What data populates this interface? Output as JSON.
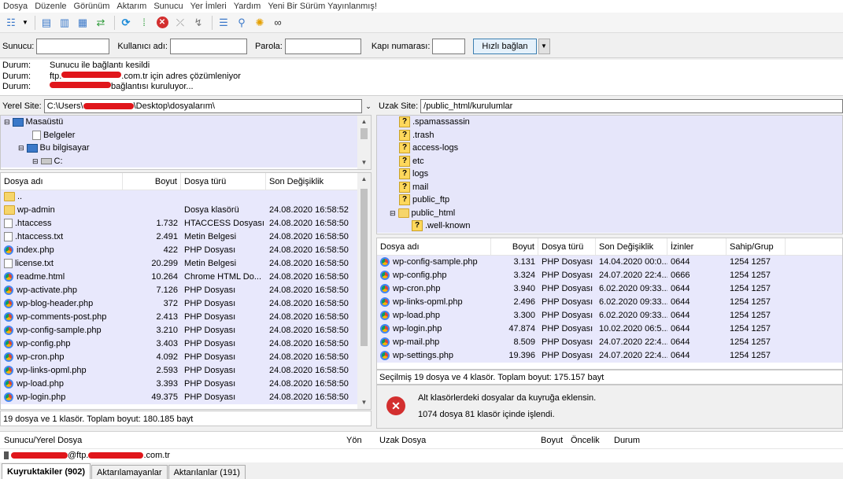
{
  "menu": [
    "Dosya",
    "Düzenle",
    "Görünüm",
    "Aktarım",
    "Sunucu",
    "Yer İmleri",
    "Yardım",
    "Yeni Bir Sürüm Yayınlanmış!"
  ],
  "quick": {
    "host_label": "Sunucu:",
    "user_label": "Kullanıcı adı:",
    "pass_label": "Parola:",
    "port_label": "Kapı numarası:",
    "connect_label": "Hızlı bağlan"
  },
  "log": [
    {
      "key": "Durum:",
      "msg": "Sunucu ile bağlantı kesildi"
    },
    {
      "key": "Durum:",
      "msg_pre": "ftp.",
      "msg_post": ".com.tr için adres çözümleniyor"
    },
    {
      "key": "Durum:",
      "msg_post": " bağlantısı kuruluyor..."
    }
  ],
  "local": {
    "label": "Yerel Site:",
    "path_pre": "C:\\Users\\",
    "path_post": "\\Desktop\\dosyalarım\\",
    "tree": [
      {
        "name": "Masaüstü",
        "icon": "monitor-icon",
        "indent": 0
      },
      {
        "name": "Belgeler",
        "icon": "document-icon",
        "indent": 1
      },
      {
        "name": "Bu bilgisayar",
        "icon": "monitor-icon",
        "indent": 1
      },
      {
        "name": "C:",
        "icon": "drive-icon",
        "indent": 2
      }
    ],
    "columns": [
      "Dosya adı",
      "Boyut",
      "Dosya türü",
      "Son Değişiklik"
    ],
    "files": [
      {
        "name": "..",
        "size": "",
        "type": "",
        "date": "",
        "icon": "folder"
      },
      {
        "name": "wp-admin",
        "size": "",
        "type": "Dosya klasörü",
        "date": "24.08.2020 16:58:52",
        "icon": "folder"
      },
      {
        "name": ".htaccess",
        "size": "1.732",
        "type": "HTACCESS Dosyası",
        "date": "24.08.2020 16:58:50",
        "icon": "file"
      },
      {
        "name": ".htaccess.txt",
        "size": "2.491",
        "type": "Metin Belgesi",
        "date": "24.08.2020 16:58:50",
        "icon": "file"
      },
      {
        "name": "index.php",
        "size": "422",
        "type": "PHP Dosyası",
        "date": "24.08.2020 16:58:50",
        "icon": "chrome"
      },
      {
        "name": "license.txt",
        "size": "20.299",
        "type": "Metin Belgesi",
        "date": "24.08.2020 16:58:50",
        "icon": "file"
      },
      {
        "name": "readme.html",
        "size": "10.264",
        "type": "Chrome HTML Do...",
        "date": "24.08.2020 16:58:50",
        "icon": "chrome"
      },
      {
        "name": "wp-activate.php",
        "size": "7.126",
        "type": "PHP Dosyası",
        "date": "24.08.2020 16:58:50",
        "icon": "chrome"
      },
      {
        "name": "wp-blog-header.php",
        "size": "372",
        "type": "PHP Dosyası",
        "date": "24.08.2020 16:58:50",
        "icon": "chrome"
      },
      {
        "name": "wp-comments-post.php",
        "size": "2.413",
        "type": "PHP Dosyası",
        "date": "24.08.2020 16:58:50",
        "icon": "chrome"
      },
      {
        "name": "wp-config-sample.php",
        "size": "3.210",
        "type": "PHP Dosyası",
        "date": "24.08.2020 16:58:50",
        "icon": "chrome"
      },
      {
        "name": "wp-config.php",
        "size": "3.403",
        "type": "PHP Dosyası",
        "date": "24.08.2020 16:58:50",
        "icon": "chrome"
      },
      {
        "name": "wp-cron.php",
        "size": "4.092",
        "type": "PHP Dosyası",
        "date": "24.08.2020 16:58:50",
        "icon": "chrome"
      },
      {
        "name": "wp-links-opml.php",
        "size": "2.593",
        "type": "PHP Dosyası",
        "date": "24.08.2020 16:58:50",
        "icon": "chrome"
      },
      {
        "name": "wp-load.php",
        "size": "3.393",
        "type": "PHP Dosyası",
        "date": "24.08.2020 16:58:50",
        "icon": "chrome"
      },
      {
        "name": "wp-login.php",
        "size": "49.375",
        "type": "PHP Dosyası",
        "date": "24.08.2020 16:58:50",
        "icon": "chrome"
      }
    ],
    "status": "19 dosya ve 1 klasör. Toplam boyut: 180.185 bayt"
  },
  "remote": {
    "label": "Uzak Site:",
    "path": "/public_html/kurulumlar",
    "tree": [
      {
        "name": ".spamassassin",
        "indent": 1
      },
      {
        "name": ".trash",
        "indent": 1
      },
      {
        "name": "access-logs",
        "indent": 1
      },
      {
        "name": "etc",
        "indent": 1
      },
      {
        "name": "logs",
        "indent": 1
      },
      {
        "name": "mail",
        "indent": 1
      },
      {
        "name": "public_ftp",
        "indent": 1
      },
      {
        "name": "public_html",
        "indent": 1,
        "folder": true
      },
      {
        "name": ".well-known",
        "indent": 2
      }
    ],
    "columns": [
      "Dosya adı",
      "Boyut",
      "Dosya türü",
      "Son Değişiklik",
      "İzinler",
      "Sahip/Grup"
    ],
    "files": [
      {
        "name": "wp-config-sample.php",
        "size": "3.131",
        "type": "PHP Dosyası",
        "date": "14.04.2020 00:0...",
        "perm": "0644",
        "owner": "1254 1257"
      },
      {
        "name": "wp-config.php",
        "size": "3.324",
        "type": "PHP Dosyası",
        "date": "24.07.2020 22:4...",
        "perm": "0666",
        "owner": "1254 1257"
      },
      {
        "name": "wp-cron.php",
        "size": "3.940",
        "type": "PHP Dosyası",
        "date": "6.02.2020 09:33...",
        "perm": "0644",
        "owner": "1254 1257"
      },
      {
        "name": "wp-links-opml.php",
        "size": "2.496",
        "type": "PHP Dosyası",
        "date": "6.02.2020 09:33...",
        "perm": "0644",
        "owner": "1254 1257"
      },
      {
        "name": "wp-load.php",
        "size": "3.300",
        "type": "PHP Dosyası",
        "date": "6.02.2020 09:33...",
        "perm": "0644",
        "owner": "1254 1257"
      },
      {
        "name": "wp-login.php",
        "size": "47.874",
        "type": "PHP Dosyası",
        "date": "10.02.2020 06:5...",
        "perm": "0644",
        "owner": "1254 1257"
      },
      {
        "name": "wp-mail.php",
        "size": "8.509",
        "type": "PHP Dosyası",
        "date": "24.07.2020 22:4...",
        "perm": "0644",
        "owner": "1254 1257"
      },
      {
        "name": "wp-settings.php",
        "size": "19.396",
        "type": "PHP Dosyası",
        "date": "24.07.2020 22:4...",
        "perm": "0644",
        "owner": "1254 1257"
      }
    ],
    "status": "Seçilmiş 19 dosya ve 4 klasör. Toplam boyut: 175.157 bayt"
  },
  "error": {
    "line1": "Alt klasörlerdeki dosyalar da kuyruğa eklensin.",
    "line2": "1074 dosya 81 klasör içinde işlendi."
  },
  "queue": {
    "columns": [
      "Sunucu/Yerel Dosya",
      "Yön",
      "Uzak Dosya",
      "Boyut",
      "Öncelik",
      "Durum"
    ],
    "entry_mid": "@ftp.",
    "entry_post": ".com.tr"
  },
  "tabs": [
    "Kuyruktakiler (902)",
    "Aktarılamayanlar",
    "Aktarılanlar (191)"
  ]
}
